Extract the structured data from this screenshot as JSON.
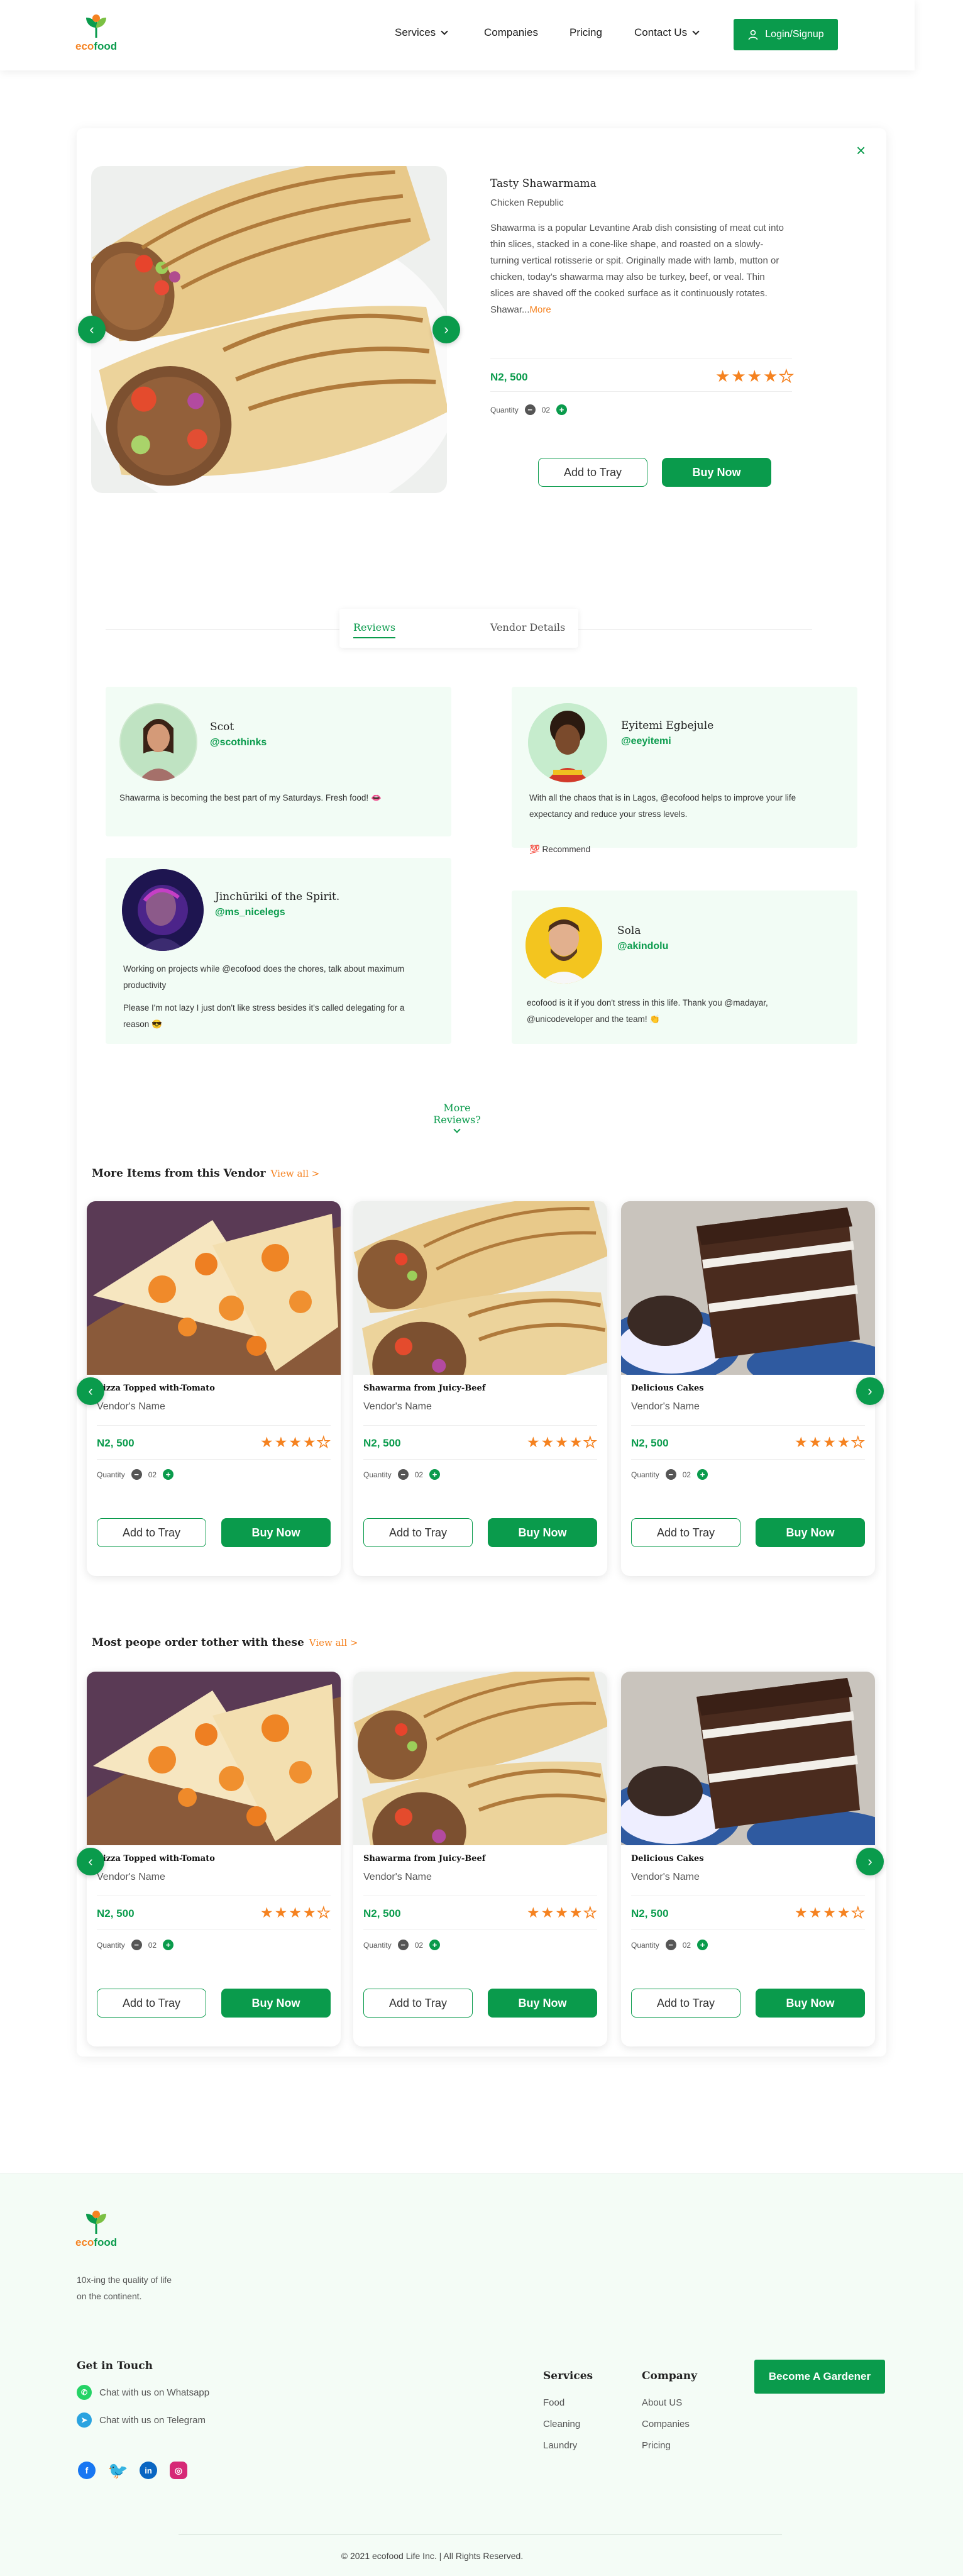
{
  "brand": {
    "name": "ecofood",
    "name_prefix": "eco",
    "name_suffix": "food"
  },
  "nav": {
    "items": [
      {
        "label": "Services",
        "dropdown": true
      },
      {
        "label": "Companies",
        "dropdown": false
      },
      {
        "label": "Pricing",
        "dropdown": false
      },
      {
        "label": "Contact Us",
        "dropdown": true
      }
    ],
    "login_label": "Login/Signup"
  },
  "product": {
    "title": "Tasty Shawarmama",
    "origin": "Chicken Republic",
    "description": "Shawarma is a popular Levantine Arab dish consisting of meat cut into thin slices, stacked in a cone-like shape, and roasted on a slowly-turning vertical rotisserie or spit. Originally made with lamb, mutton or chicken, today's shawarma may also be turkey, beef, or veal. Thin slices are shaved off the cooked surface as it continuously rotates. Shawar...",
    "more_label": "More",
    "price": "N2, 500",
    "rating": 4,
    "rating_max": 5,
    "quantity_label": "Quantity",
    "quantity": "02",
    "add_to_tray": "Add to Tray",
    "buy_now": "Buy Now",
    "close_icon": "close-icon"
  },
  "tabs": [
    {
      "label": "Reviews",
      "active": true
    },
    {
      "label": "Vendor Details",
      "active": false
    }
  ],
  "reviews": [
    {
      "name": "Scot",
      "handle": "@scothinks",
      "text": "Shawarma is becoming the best part of my Saturdays. Fresh food! 👄"
    },
    {
      "name": "Eyitemi Egbejule",
      "handle": "@eeyitemi",
      "text": "With all the chaos that is in Lagos, @ecofood helps to improve your life expectancy and reduce your stress levels.",
      "extra": "💯 Recommend"
    },
    {
      "name": "Jinchūriki of the Spirit.",
      "handle": "@ms_nicelegs",
      "text": "Working on projects while @ecofood does the chores, talk about maximum productivity",
      "text2": "Please I'm not lazy I just don't like stress besides it's called delegating for a reason 😎"
    },
    {
      "name": "Sola",
      "handle": "@akindolu",
      "text": "ecofood is it if you don't stress in this life. Thank you @madayar, @unicodeveloper and the team! 👏"
    }
  ],
  "more_reviews_label": "More Reviews?",
  "sections": [
    {
      "title": "More Items from this Vendor",
      "view_all": "View all >"
    },
    {
      "title": "Most peope order tother with these",
      "view_all": "View all >"
    }
  ],
  "items": [
    {
      "title": "Pizza Topped with-Tomato",
      "vendor": "Vendor's Name",
      "price": "N2, 500",
      "rating": 4,
      "quantity_label": "Quantity",
      "quantity": "02",
      "add_to_tray": "Add to Tray",
      "buy_now": "Buy Now"
    },
    {
      "title": "Shawarma from Juicy-Beef",
      "vendor": "Vendor's Name",
      "price": "N2, 500",
      "rating": 4,
      "quantity_label": "Quantity",
      "quantity": "02",
      "add_to_tray": "Add to Tray",
      "buy_now": "Buy Now"
    },
    {
      "title": "Delicious Cakes",
      "vendor": "Vendor's Name",
      "price": "N2, 500",
      "rating": 4,
      "quantity_label": "Quantity",
      "quantity": "02",
      "add_to_tray": "Add to Tray",
      "buy_now": "Buy Now"
    }
  ],
  "footer": {
    "tagline_line1": "10x-ing the quality of life",
    "tagline_line2": "on the continent.",
    "get_in_touch": "Get in Touch",
    "whatsapp": "Chat with us on Whatsapp",
    "telegram": "Chat with us on Telegram",
    "services_title": "Services",
    "services": [
      "Food",
      "Cleaning",
      "Laundry"
    ],
    "company_title": "Company",
    "company": [
      "About US",
      "Companies",
      "Pricing"
    ],
    "cta": "Become A Gardener",
    "copyright": "© 2021 ecofood Life Inc. | All Rights Reserved."
  },
  "colors": {
    "brand_green": "#0a9b4c",
    "accent_orange": "#f58220",
    "review_bg": "#f2fcf5"
  }
}
